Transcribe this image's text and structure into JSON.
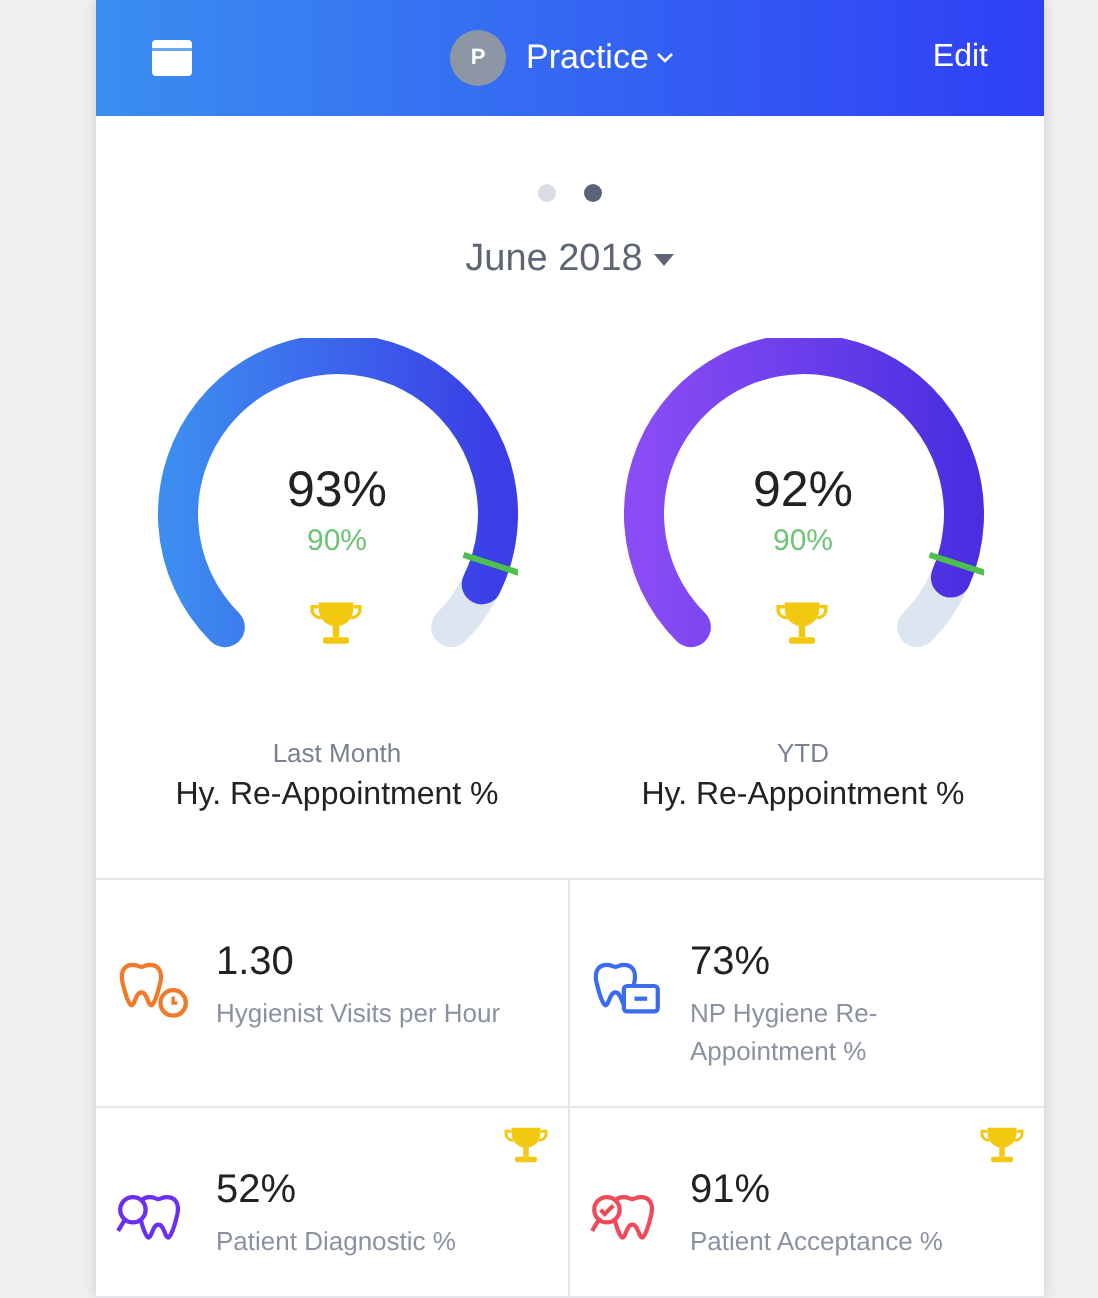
{
  "header": {
    "title": "Practice",
    "avatar": "P",
    "action": "Edit"
  },
  "pager": [
    {
      "selected": false
    },
    {
      "selected": true
    }
  ],
  "period": "June 2018",
  "gauges": [
    {
      "value": "93%",
      "target": "90%",
      "trophy": true,
      "caption": "Last Month",
      "label": "Hy. Re-Appointment %"
    },
    {
      "value": "92%",
      "target": "90%",
      "trophy": true,
      "caption": "YTD",
      "label": "Hy. Re-Appointment %"
    }
  ],
  "tiles": [
    {
      "value": "1.30",
      "label": "Hygienist Visits per Hour",
      "kind": "clock",
      "color": "#f07a2a",
      "trophy": false
    },
    {
      "value": "73%",
      "label": "NP Hygiene Re-Appointment %",
      "kind": "card",
      "color": "#3b6cf0",
      "trophy": false
    },
    {
      "value": "52%",
      "label": "Patient Diagnostic %",
      "kind": "search",
      "color": "#6a2ff0",
      "trophy": true
    },
    {
      "value": "91%",
      "label": "Patient Acceptance %",
      "kind": "check",
      "color": "#f04a5a",
      "trophy": true
    }
  ]
}
